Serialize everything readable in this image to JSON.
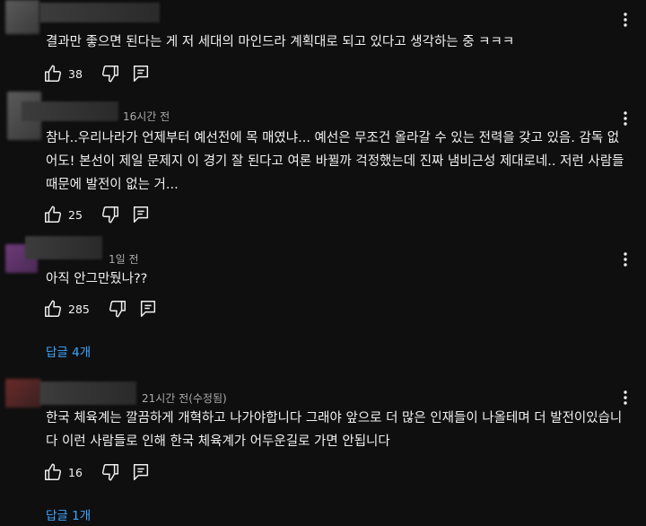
{
  "comments": [
    {
      "time": "",
      "text": "결과만 좋으면 된다는 게 저 세대의 마인드라 계획대로 되고 있다고 생각하는 중 ㅋㅋㅋ",
      "likes": "38",
      "replies": ""
    },
    {
      "time": "16시간 전",
      "text": "참나..우리나라가 언제부터 예선전에 목 매였냐... 예선은 무조건 올라갈 수 있는 전력을 갖고 있음. 감독 없어도! 본선이 제일 문제지 이 경기 잘 된다고 여론 바뀔까 걱정했는데 진짜 냄비근성 제대로네.. 저런 사람들 때문에 발전이 없는 거...",
      "likes": "25",
      "replies": ""
    },
    {
      "time": "1일 전",
      "text": "아직 안그만뒀나??",
      "likes": "285",
      "replies": "답글 4개"
    },
    {
      "time": "21시간 전(수정됨)",
      "text": "한국 체육계는 깔끔하게 개혁하고 나가야합니다 그래야 앞으로 더 많은 인재들이 나올테며 더 발전이있습니다 이런 사람들로 인해 한국 체육계가 어두운길로 가면 안됩니다",
      "likes": "16",
      "replies": "답글 1개"
    }
  ],
  "icons": {
    "like": "thumbs-up-icon",
    "dislike": "thumbs-down-icon",
    "reply": "reply-icon",
    "more": "more-vert-icon"
  },
  "colors": {
    "background": "#0f0f0f",
    "text": "#f1f1f1",
    "secondary_text": "#aaaaaa",
    "link": "#3ea6ff"
  }
}
